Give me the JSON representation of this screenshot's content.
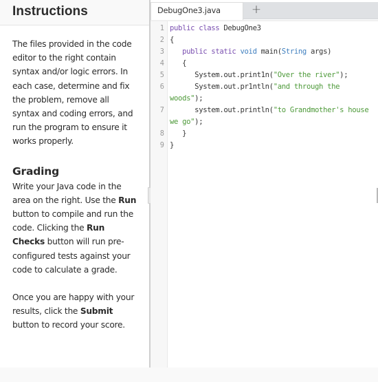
{
  "instructions": {
    "title": "Instructions",
    "intro": "The files provided in the code editor to the right contain syntax and/or logic errors. In each case, determine and fix the problem, remove all syntax and coding errors, and run the program to ensure it works properly.",
    "grading_heading": "Grading",
    "grading": {
      "t1": "Write your Java code in the area on the right. Use the ",
      "b1": "Run",
      "t2": " button to compile and run the code. Clicking the ",
      "b2": "Run Checks",
      "t3": " button will run pre-configured tests against your code to calculate a grade."
    },
    "submit": {
      "t1": "Once you are happy with your results, click the ",
      "b1": "Submit",
      "t2": " button to record your score."
    }
  },
  "editor": {
    "tabs": [
      {
        "label": "DebugOne3.java",
        "active": true
      }
    ],
    "add_tab_icon": "+",
    "lines": [
      {
        "num": "1",
        "tokens": [
          {
            "t": "public class ",
            "c": "kw"
          },
          {
            "t": "DebugOne3",
            "c": "plain"
          }
        ]
      },
      {
        "num": "2",
        "tokens": [
          {
            "t": "{",
            "c": "plain"
          }
        ]
      },
      {
        "num": "3",
        "tokens": [
          {
            "t": "   public static ",
            "c": "kw"
          },
          {
            "t": "void",
            "c": "ty"
          },
          {
            "t": " main(",
            "c": "plain"
          },
          {
            "t": "String",
            "c": "ty"
          },
          {
            "t": " args)",
            "c": "plain"
          }
        ]
      },
      {
        "num": "4",
        "tokens": [
          {
            "t": "   {",
            "c": "plain"
          }
        ]
      },
      {
        "num": "5",
        "tokens": [
          {
            "t": "      System.out.print1n(",
            "c": "plain"
          },
          {
            "t": "\"Over the river\"",
            "c": "str"
          },
          {
            "t": ");",
            "c": "plain"
          }
        ]
      },
      {
        "num": "6",
        "tokens": [
          {
            "t": "      System.out.pr1ntln(",
            "c": "plain"
          },
          {
            "t": "\"and through the woods\"",
            "c": "str"
          },
          {
            "t": ");",
            "c": "plain"
          }
        ]
      },
      {
        "num": "7",
        "tokens": [
          {
            "t": "      system.out.println(",
            "c": "plain"
          },
          {
            "t": "\"to Grandmother's house we go\"",
            "c": "str"
          },
          {
            "t": ");",
            "c": "plain"
          }
        ]
      },
      {
        "num": "8",
        "tokens": [
          {
            "t": "   }",
            "c": "plain"
          }
        ]
      },
      {
        "num": "9",
        "tokens": [
          {
            "t": "}",
            "c": "plain"
          }
        ]
      }
    ]
  }
}
